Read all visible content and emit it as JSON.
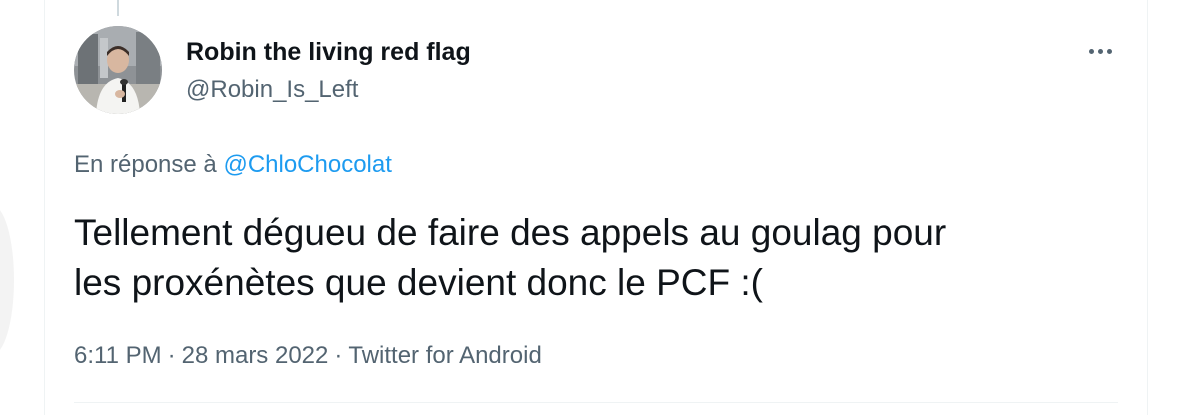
{
  "tweet": {
    "author": {
      "display_name": "Robin the living red flag",
      "handle": "@Robin_Is_Left"
    },
    "reply_context": {
      "prefix": "En réponse à",
      "mention": "@ChloChocolat"
    },
    "text_lines": [
      "Tellement dégueu de faire des appels au goulag pour",
      "les proxénètes que devient donc le PCF :("
    ],
    "meta": {
      "time": "6:11 PM",
      "separator": "·",
      "date": "28 mars 2022",
      "source": "Twitter for Android"
    },
    "icons": {
      "more": "more-options-icon",
      "avatar": "profile-photo"
    }
  },
  "colors": {
    "text_primary": "#0f1419",
    "text_secondary": "#536471",
    "link": "#1d9bf0",
    "border": "#eff3f4",
    "thread_line": "#cfd9de"
  }
}
